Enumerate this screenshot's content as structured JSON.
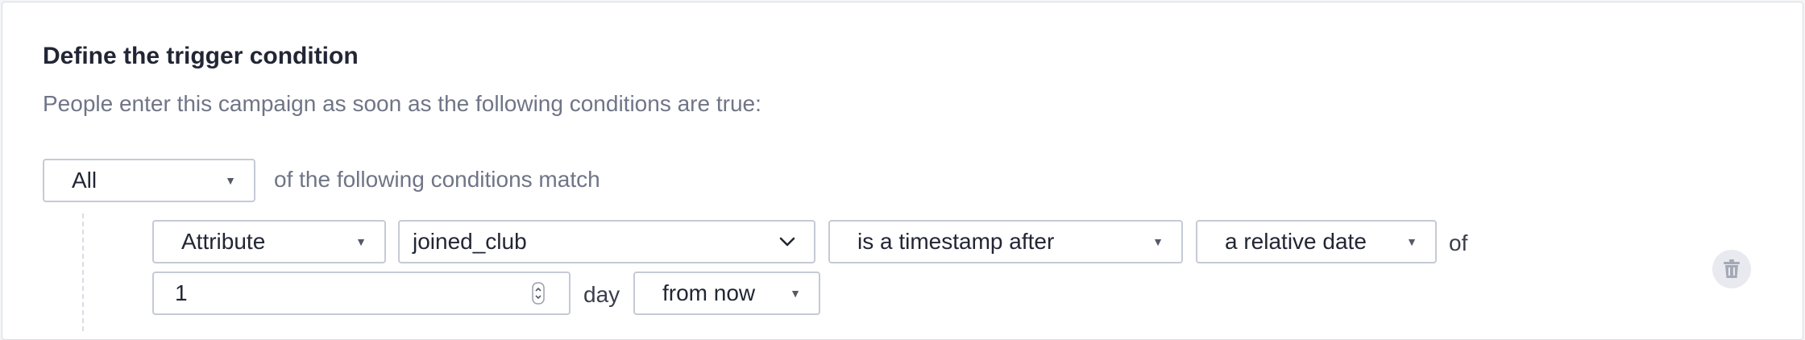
{
  "section": {
    "title": "Define the trigger condition",
    "subtitle": "People enter this campaign as soon as the following conditions are true:"
  },
  "match": {
    "selected": "All",
    "suffix": "of the following conditions match"
  },
  "condition": {
    "type_selected": "Attribute",
    "attribute_selected": "joined_club",
    "operator_selected": "is a timestamp after",
    "date_mode_selected": "a relative date",
    "of_text": "of",
    "amount_value": "1",
    "unit_text": "day",
    "direction_selected": "from now"
  },
  "icons": {
    "caret": "caret-down-icon",
    "chevron": "chevron-down-icon",
    "stepper": "number-stepper-icon",
    "delete": "trash-icon"
  },
  "colors": {
    "title": "#222634",
    "muted_text": "#6f7586",
    "border": "#c6cad6",
    "delete_bg": "#e8eaef",
    "delete_icon": "#a4a9b6"
  }
}
